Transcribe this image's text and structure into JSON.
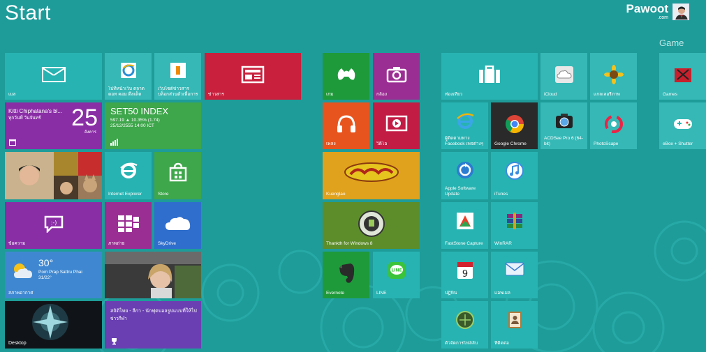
{
  "screen": {
    "title": "Start"
  },
  "user": {
    "name": "Pawoot",
    "subtitle": ".com"
  },
  "groups": {
    "games_label": "Game"
  },
  "tiles": {
    "mail": "เมล",
    "ie_pin1": "ไปที่หน้าเว็บ ตลาดดอท คอม ดีลเด็ด",
    "ie_pin2": "เว็บไซต์ข่าวสาร บล็อกส่วนตัวเพื่อการ",
    "news": "ข่าวสาร",
    "xbox": "เกม",
    "camera": "กล้อง",
    "travel": "ท่องเที่ยว",
    "icloud": "iCloud",
    "photo_gallery": "แกลเลอรีภาพ",
    "games": "Games",
    "people_title": "Kitti Chiphatana's bl...",
    "people_sub": "ทุกวันที่ วันจันทร์",
    "calendar_day": "25",
    "calendar_sub": "อังคาร",
    "finance_title": "SET50 INDEX",
    "finance_sub1": "597.19 ▲ 10.35% (1.74)",
    "finance_sub2": "25/12/2555 14:00 ICT",
    "music": "เพลง",
    "video": "วิดีโอ",
    "fb_ie": "ผู้ติดตามทาง Facebook เพจต่างๆ",
    "chrome": "Google Chrome",
    "acdsee": "ACDSee Pro 6 (64-bit)",
    "photoscape": "PhotoScape",
    "eboxplus": "eBox + Shutter",
    "photos_tile": "",
    "ie": "Internet Explorer",
    "store": "Store",
    "kuenglao": "Kuenglao",
    "apple_update": "Apple Software Update",
    "itunes": "iTunes",
    "messaging": "ข้อความ",
    "photos2": "ภาพถ่าย",
    "skydrive": "SkyDrive",
    "thanks": "Thankth for Windows 8",
    "faststone": "FastStone Capture",
    "winrar": "WinRAR",
    "weather_temp": "30°",
    "weather_place": "Pom Prap Sattru Phai",
    "weather_range": "31/22°",
    "weather_label": "สภาพอากาศ",
    "evernote": "Evernote",
    "line": "LINE",
    "calendar_app": "ปฏิทิน",
    "mail2": "แอพเมล",
    "desktop": "Desktop",
    "news_headline": "สถิติไทย - ลีกา - นักฟุตบอลรูปแบบที่ให้ไป",
    "news_source": "ข่าวกีฬา",
    "daily_shot": "ตัวจัดการไฟล์ลับ",
    "contacts": "ที่ติดต่อ"
  },
  "colors": {
    "background": "#1e9c9a",
    "teal": "#27b3b1",
    "red": "#c8203d",
    "green": "#1e9a3a",
    "purple": "#8a2ea6",
    "orange": "#e8541e",
    "blue": "#2f6ecc"
  }
}
